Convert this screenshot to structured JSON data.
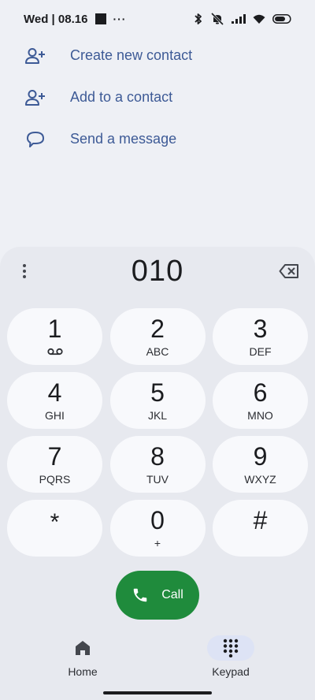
{
  "status_bar": {
    "time": "Wed | 08.16",
    "overflow": "···",
    "icons": [
      "bluetooth-icon",
      "silent-bell-icon",
      "signal-icon",
      "wifi-icon",
      "battery-icon"
    ]
  },
  "actions": [
    {
      "label": "Create new contact",
      "icon": "add-person-icon"
    },
    {
      "label": "Add to a contact",
      "icon": "add-person-icon"
    },
    {
      "label": "Send a message",
      "icon": "message-icon"
    }
  ],
  "dialer": {
    "number": "010",
    "keys": [
      {
        "digit": "1",
        "letters": ""
      },
      {
        "digit": "2",
        "letters": "ABC"
      },
      {
        "digit": "3",
        "letters": "DEF"
      },
      {
        "digit": "4",
        "letters": "GHI"
      },
      {
        "digit": "5",
        "letters": "JKL"
      },
      {
        "digit": "6",
        "letters": "MNO"
      },
      {
        "digit": "7",
        "letters": "PQRS"
      },
      {
        "digit": "8",
        "letters": "TUV"
      },
      {
        "digit": "9",
        "letters": "WXYZ"
      },
      {
        "digit": "*",
        "letters": ""
      },
      {
        "digit": "0",
        "letters": "+"
      },
      {
        "digit": "#",
        "letters": ""
      }
    ],
    "call_label": "Call"
  },
  "nav": {
    "home_label": "Home",
    "keypad_label": "Keypad",
    "selected": "Keypad"
  },
  "colors": {
    "accent": "#3d5a96",
    "call_green": "#1f8b3c",
    "selected_pill": "#dde3f5"
  }
}
